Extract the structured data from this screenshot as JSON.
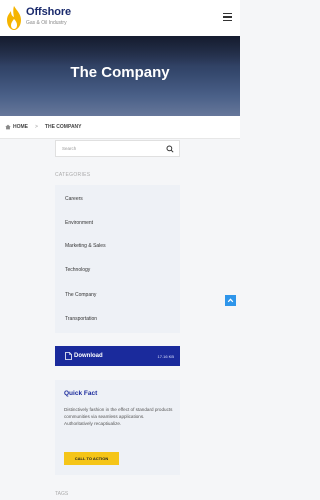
{
  "header": {
    "brand": "Offshore",
    "tagline": "Gas & Oil Industry"
  },
  "hero": {
    "title": "The Company"
  },
  "breadcrumb": {
    "home": "HOME",
    "separator": ">",
    "current": "THE COMPANY"
  },
  "search": {
    "placeholder": "Search"
  },
  "sidebar": {
    "categories_heading": "CATEGORIES",
    "categories": [
      "Careers",
      "Environment",
      "Marketing & Sales",
      "Technology",
      "The Company",
      "Transportation"
    ],
    "download": {
      "label": "Download",
      "size": "17.16 KB"
    },
    "quick_fact": {
      "title": "Quick Fact",
      "text": "Distinctively fashion in the effect of standard products communities via seamless applications. Authoritatively recaptiualize.",
      "cta": "CALL TO ACTION"
    },
    "tags_heading": "TAGS"
  },
  "colors": {
    "brand_navy": "#1a2a6c",
    "download_bg": "#1a2a9c",
    "cta_yellow": "#f5c518",
    "scroll_button": "#2e95ea",
    "flame": "#f5b400"
  }
}
